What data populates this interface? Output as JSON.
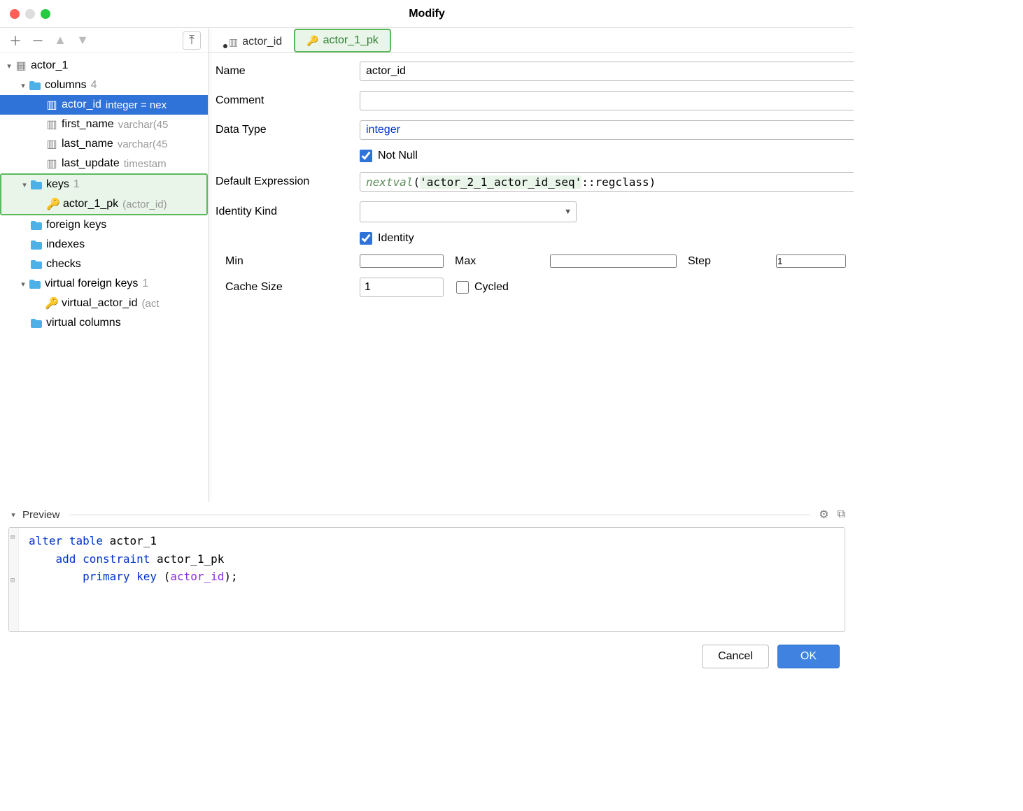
{
  "window": {
    "title": "Modify"
  },
  "tree": {
    "root": {
      "label": "actor_1"
    },
    "columns": {
      "label": "columns",
      "count": "4"
    },
    "col_actor_id": {
      "name": "actor_id",
      "type": "integer = nex"
    },
    "col_first_name": {
      "name": "first_name",
      "type": "varchar(45"
    },
    "col_last_name": {
      "name": "last_name",
      "type": "varchar(45"
    },
    "col_last_update": {
      "name": "last_update",
      "type": "timestam"
    },
    "keys": {
      "label": "keys",
      "count": "1"
    },
    "key_pk": {
      "name": "actor_1_pk",
      "cols": "(actor_id)"
    },
    "foreign_keys": {
      "label": "foreign keys"
    },
    "indexes": {
      "label": "indexes"
    },
    "checks": {
      "label": "checks"
    },
    "vfk": {
      "label": "virtual foreign keys",
      "count": "1"
    },
    "vfk_item": {
      "name": "virtual_actor_id",
      "cols": "(act"
    },
    "vcols": {
      "label": "virtual columns"
    }
  },
  "tabs": {
    "col": "actor_id",
    "key": "actor_1_pk"
  },
  "form": {
    "name_label": "Name",
    "name_value": "actor_id",
    "comment_label": "Comment",
    "datatype_label": "Data Type",
    "datatype_value": "integer",
    "notnull_label": "Not Null",
    "notnull_checked": true,
    "defexpr_label": "Default Expression",
    "defexpr_fn": "nextval",
    "defexpr_str": "'actor_2_1_actor_id_seq'",
    "defexpr_rest": "::regclass)",
    "identity_kind_label": "Identity Kind",
    "identity_label": "Identity",
    "identity_checked": true,
    "min_label": "Min",
    "min_value": "",
    "max_label": "Max",
    "max_value": "",
    "step_label": "Step",
    "step_value": "1",
    "cache_label": "Cache Size",
    "cache_value": "1",
    "cycled_label": "Cycled",
    "cycled_checked": false
  },
  "preview": {
    "label": "Preview",
    "sql": {
      "l1_kw1": "alter",
      "l1_kw2": "table",
      "l1_id": "actor_1",
      "l2_kw1": "add",
      "l2_kw2": "constraint",
      "l2_id": "actor_1_pk",
      "l3_kw1": "primary",
      "l3_kw2": "key",
      "l3_id": "actor_id"
    }
  },
  "footer": {
    "cancel": "Cancel",
    "ok": "OK"
  }
}
